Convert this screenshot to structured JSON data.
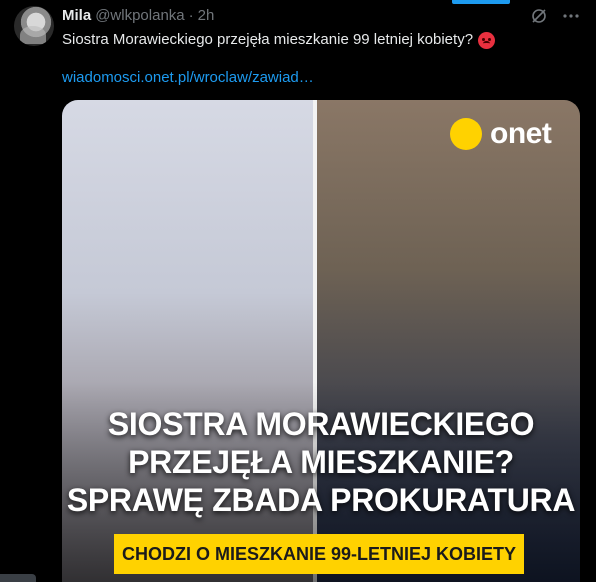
{
  "tweet": {
    "author_name": "Mila",
    "author_handle": "@wlkpolanka",
    "separator": "·",
    "time": "2h",
    "text": "Siostra Morawieckiego przejęła mieszkanie 99 letniej kobiety?",
    "link": "wiadomosci.onet.pl/wroclaw/zawiad…",
    "icons": {
      "grok": "grok-icon",
      "more": "more-icon",
      "emoji": "angry-face-icon"
    }
  },
  "media": {
    "logo_text": "onet",
    "headline_lines": [
      "SIOSTRA MORAWIECKIEGO",
      "PRZEJĘŁA MIESZKANIE?",
      "SPRAWĘ ZBADA PROKURATURA"
    ],
    "banner": "CHODZI O MIESZKANIE 99-LETNIEJ KOBIETY"
  },
  "colors": {
    "accent": "#1d9bf0",
    "onet_yellow": "#ffd200",
    "background": "#000000"
  }
}
